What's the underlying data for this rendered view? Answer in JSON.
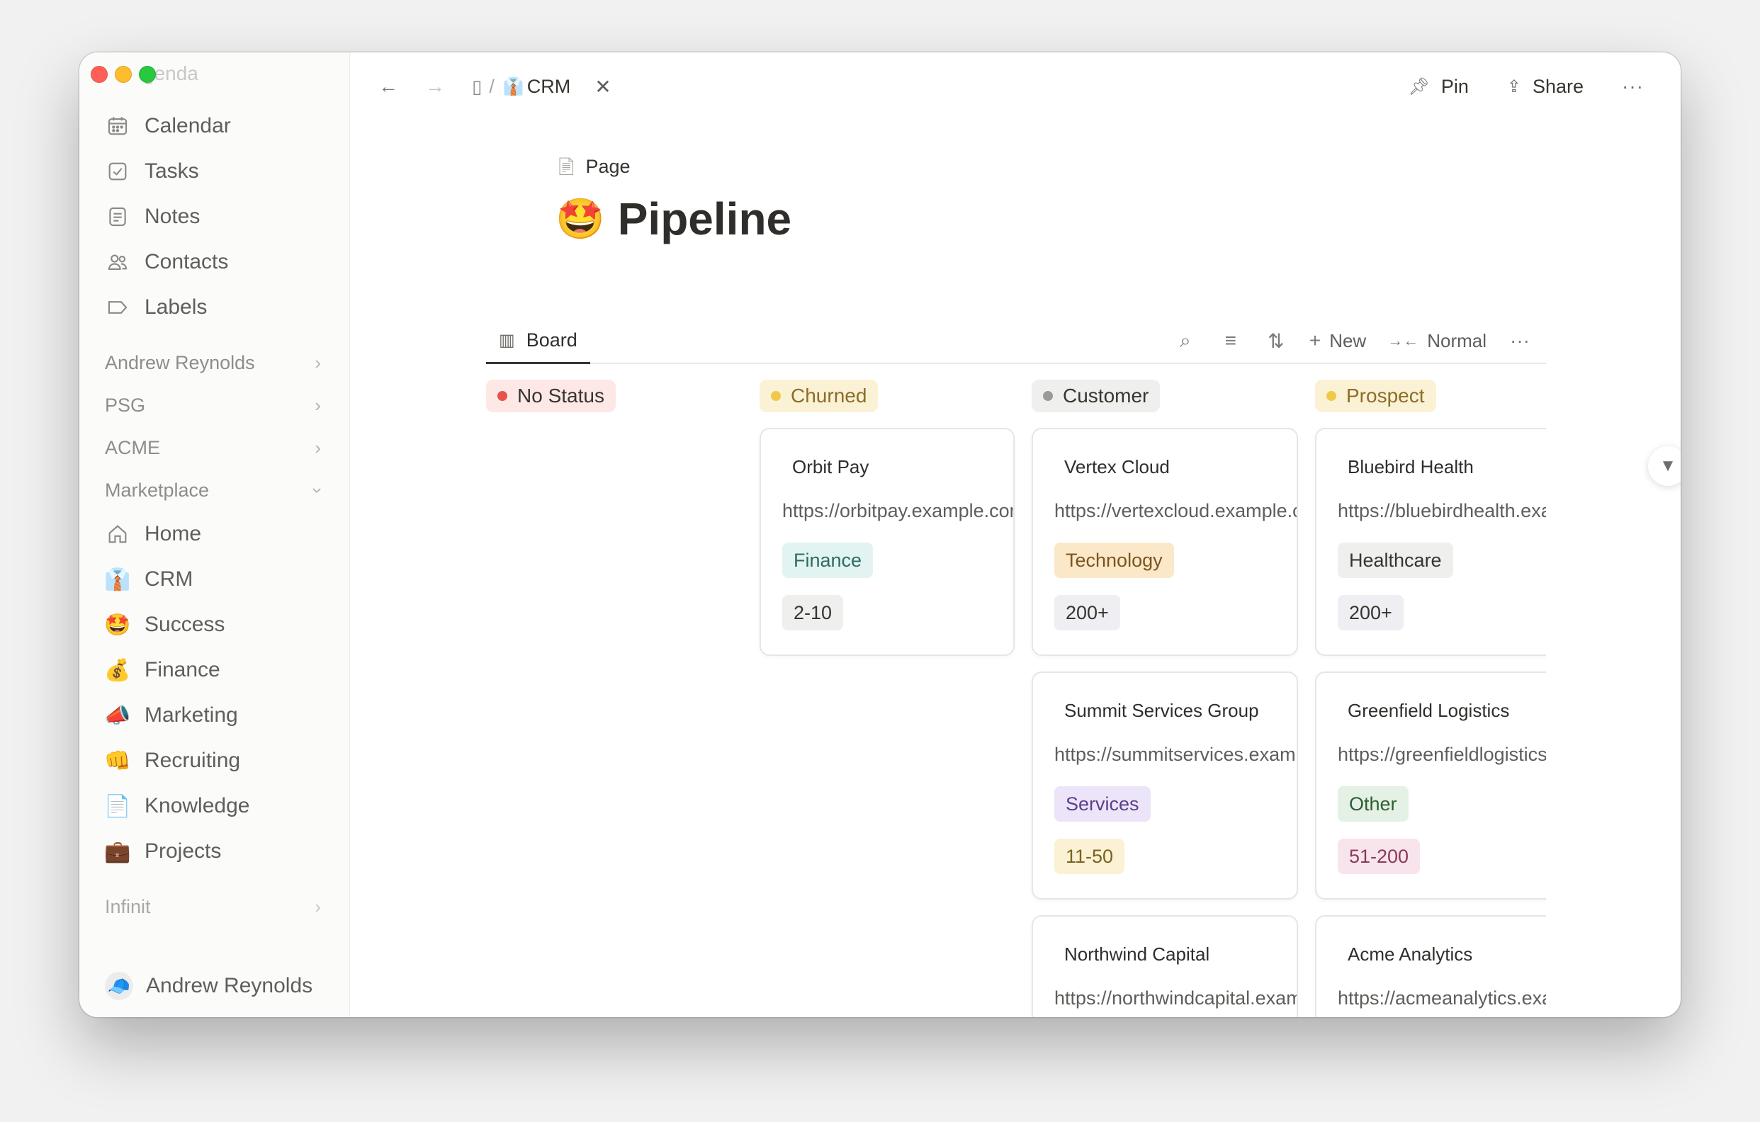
{
  "sidebar": {
    "faded_header": "genda",
    "items": [
      {
        "label": "Calendar",
        "icon": "calendar-icon"
      },
      {
        "label": "Tasks",
        "icon": "checkbox-icon"
      },
      {
        "label": "Notes",
        "icon": "note-icon"
      },
      {
        "label": "Contacts",
        "icon": "contacts-icon"
      },
      {
        "label": "Labels",
        "icon": "label-icon"
      }
    ],
    "sections": [
      {
        "label": "Andrew Reynolds"
      },
      {
        "label": "PSG"
      },
      {
        "label": "ACME"
      },
      {
        "label": "Marketplace"
      }
    ],
    "marketplace_items": [
      {
        "label": "Home",
        "icon": "🏠"
      },
      {
        "label": "CRM",
        "icon": "👔"
      },
      {
        "label": "Success",
        "icon": "🤩"
      },
      {
        "label": "Finance",
        "icon": "💰"
      },
      {
        "label": "Marketing",
        "icon": "📣"
      },
      {
        "label": "Recruiting",
        "icon": "👊"
      },
      {
        "label": "Knowledge",
        "icon": "📄"
      },
      {
        "label": "Projects",
        "icon": "💼"
      }
    ],
    "infinit": "Infinit",
    "user": {
      "name": "Andrew Reynolds",
      "avatar": "🧢"
    }
  },
  "topbar": {
    "crumb_icon": "👔",
    "crumb_sep": "/",
    "crumb_label": "CRM",
    "pin_label": "Pin",
    "share_label": "Share"
  },
  "page": {
    "type_label": "Page",
    "title_emoji": "🤩",
    "title": "Pipeline"
  },
  "view": {
    "tab_label": "Board",
    "new_label": "New",
    "density_label": "Normal"
  },
  "board": {
    "columns": [
      {
        "label": "No Status",
        "dot": "#e5534b",
        "bg": "#fde8e6",
        "fg": "#37352f"
      },
      {
        "label": "Churned",
        "dot": "#f1c94a",
        "bg": "#fbf1d4",
        "fg": "#8a6e28"
      },
      {
        "label": "Customer",
        "dot": "#9b9a97",
        "bg": "#efefed",
        "fg": "#37352f"
      },
      {
        "label": "Prospect",
        "dot": "#f1c94a",
        "bg": "#fbf1d4",
        "fg": "#8a6e28"
      }
    ],
    "cards": {
      "churned": [
        {
          "name": "Orbit Pay",
          "url": "https://orbitpay.example.com",
          "tag": "Finance",
          "size": "2-10"
        }
      ],
      "customer": [
        {
          "name": "Vertex Cloud",
          "url": "https://vertexcloud.example.com",
          "tag": "Technology",
          "size": "200+"
        },
        {
          "name": "Summit Services Group",
          "url": "https://summitservices.example.com",
          "tag": "Services",
          "size": "11-50"
        },
        {
          "name": "Northwind Capital",
          "url": "https://northwindcapital.example.com"
        }
      ],
      "prospect": [
        {
          "name": "Bluebird Health",
          "url": "https://bluebirdhealth.example.com",
          "tag": "Healthcare",
          "size": "200+"
        },
        {
          "name": "Greenfield Logistics",
          "url": "https://greenfieldlogistics.example.com",
          "tag": "Other",
          "size": "51-200"
        },
        {
          "name": "Acme Analytics",
          "url": "https://acmeanalytics.example.com"
        }
      ]
    },
    "tag_colors": {
      "Finance": {
        "bg": "#e2f4f2",
        "fg": "#2f6b63"
      },
      "Technology": {
        "bg": "#fbe8c8",
        "fg": "#7a5520"
      },
      "Healthcare": {
        "bg": "#efefed",
        "fg": "#37352f"
      },
      "Services": {
        "bg": "#ece4f8",
        "fg": "#5b3f8a"
      },
      "Other": {
        "bg": "#e4f1e4",
        "fg": "#2f5e34"
      }
    },
    "size_colors": {
      "2-10": {
        "bg": "#efefed",
        "fg": "#37352f"
      },
      "200+": {
        "bg": "#eeeef3",
        "fg": "#37352f"
      },
      "11-50": {
        "bg": "#fbf1d4",
        "fg": "#7a6320"
      },
      "51-200": {
        "bg": "#f8e4ec",
        "fg": "#8a3b5a"
      }
    }
  }
}
